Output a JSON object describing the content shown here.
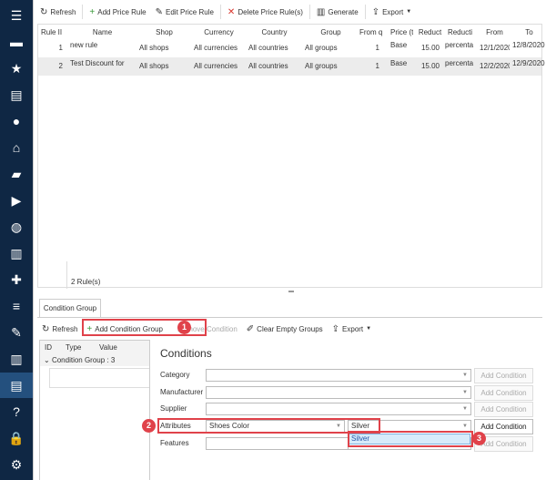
{
  "sidebar": {
    "items": [
      "menu-icon",
      "store-icon",
      "star-icon",
      "inbox-icon",
      "user-icon",
      "basket-icon",
      "comment-icon",
      "truck-icon",
      "globe-icon",
      "chart-icon",
      "puzzle-icon",
      "sliders-icon",
      "wrench-icon",
      "report-icon",
      "archive-icon",
      "help-icon",
      "lock-icon",
      "gear-icon"
    ],
    "glyphs": [
      "☰",
      "▬",
      "★",
      "▤",
      "●",
      "⌂",
      "▰",
      "▶",
      "◍",
      "▥",
      "✚",
      "≡",
      "✎",
      "▥",
      "▤",
      "?",
      "🔒",
      "⚙"
    ],
    "active_index": 14,
    "bg": "#0f2744",
    "active_bg": "#24507e"
  },
  "toolbar": {
    "refresh": "Refresh",
    "add": "Add Price Rule",
    "edit": "Edit Price Rule",
    "delete": "Delete Price Rule(s)",
    "generate": "Generate",
    "export": "Export"
  },
  "grid": {
    "columns": [
      "Rule II",
      "Name",
      "Shop",
      "Currency",
      "Country",
      "Group",
      "From q",
      "Price (t:",
      "Reduct",
      "Reducti",
      "From",
      "To"
    ],
    "rows": [
      [
        "1",
        "new rule",
        "All shops",
        "All currencies",
        "All countries",
        "All groups",
        "1",
        "Base",
        "15.00",
        "percenta",
        "12/1/2020",
        "12/8/2020"
      ],
      [
        "2",
        "Test Discount for",
        "All shops",
        "All currencies",
        "All countries",
        "All groups",
        "1",
        "Base",
        "15.00",
        "percenta",
        "12/2/2020",
        "12/9/2020"
      ]
    ],
    "footer": "2 Rule(s)"
  },
  "bottom": {
    "tab": "Condition Group",
    "toolbar": {
      "refresh": "Refresh",
      "add_group": "Add Condition Group",
      "remove": "Remove Condition",
      "clear": "Clear Empty Groups",
      "export": "Export"
    },
    "tree": {
      "columns": [
        "ID",
        "Type",
        "Value"
      ],
      "group": "Condition Group : 3"
    },
    "conditions": {
      "title": "Conditions",
      "add_label": "Add Condition",
      "rows": [
        {
          "label": "Category",
          "value": ""
        },
        {
          "label": "Manufacturer",
          "value": ""
        },
        {
          "label": "Supplier",
          "value": ""
        },
        {
          "label": "Attributes",
          "value": "Shoes Color",
          "value2": "Silver"
        },
        {
          "label": "Features",
          "value": ""
        }
      ],
      "dropdown_option": "Silver"
    },
    "badges": [
      "1",
      "2",
      "3"
    ]
  },
  "colors": {
    "highlight": "#e0424a",
    "accent_green": "#3a9a3a",
    "delete_red": "#d9342b"
  }
}
